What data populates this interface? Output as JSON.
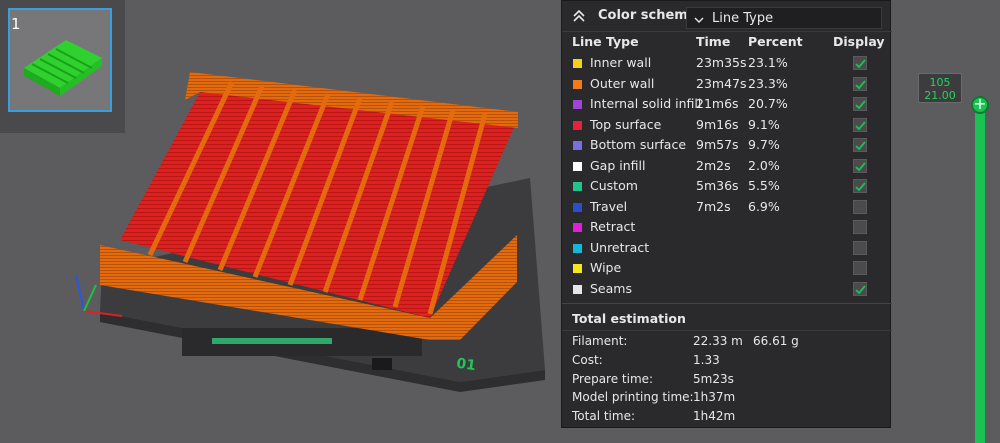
{
  "thumbnail": {
    "number": "1"
  },
  "panel": {
    "header_title": "Color scheme",
    "scheme_value": "Line Type",
    "columns": {
      "line_type": "Line Type",
      "time": "Time",
      "percent": "Percent",
      "display": "Display"
    },
    "rows": [
      {
        "name": "Inner wall",
        "time": "23m35s",
        "percent": "23.1%",
        "color": "#f2d21c",
        "checked": true
      },
      {
        "name": "Outer wall",
        "time": "23m47s",
        "percent": "23.3%",
        "color": "#f07a1c",
        "checked": true
      },
      {
        "name": "Internal solid infill",
        "time": "21m6s",
        "percent": "20.7%",
        "color": "#a044d8",
        "checked": true
      },
      {
        "name": "Top surface",
        "time": "9m16s",
        "percent": "9.1%",
        "color": "#e8213a",
        "checked": true
      },
      {
        "name": "Bottom surface",
        "time": "9m57s",
        "percent": "9.7%",
        "color": "#7a6fe0",
        "checked": true
      },
      {
        "name": "Gap infill",
        "time": "2m2s",
        "percent": "2.0%",
        "color": "#ffffff",
        "checked": true
      },
      {
        "name": "Custom",
        "time": "5m36s",
        "percent": "5.5%",
        "color": "#1ec48a",
        "checked": true
      },
      {
        "name": "Travel",
        "time": "7m2s",
        "percent": "6.9%",
        "color": "#2a4fc8",
        "checked": false
      },
      {
        "name": "Retract",
        "time": "",
        "percent": "",
        "color": "#e020d8",
        "checked": false
      },
      {
        "name": "Unretract",
        "time": "",
        "percent": "",
        "color": "#12b8d8",
        "checked": false
      },
      {
        "name": "Wipe",
        "time": "",
        "percent": "",
        "color": "#f2e81c",
        "checked": false
      },
      {
        "name": "Seams",
        "time": "",
        "percent": "",
        "color": "#e6e6e6",
        "checked": true
      }
    ],
    "total_title": "Total estimation",
    "estimation": [
      {
        "label": "Filament:",
        "value": "22.33 m",
        "value2": "66.61 g"
      },
      {
        "label": "Cost:",
        "value": "1.33",
        "value2": ""
      },
      {
        "label": "Prepare time:",
        "value": "5m23s",
        "value2": ""
      },
      {
        "label": "Model printing time:",
        "value": "1h37m",
        "value2": ""
      },
      {
        "label": "Total time:",
        "value": "1h42m",
        "value2": ""
      }
    ]
  },
  "layer_slider": {
    "layer": "105",
    "height": "21.00"
  },
  "plate": {
    "number_label": "01"
  },
  "colors": {
    "accent_green": "#19c251",
    "selection_blue": "#3aa0dc",
    "panel_bg": "#2a2a2c",
    "orange": "#e86c10",
    "red": "#e8213a"
  }
}
